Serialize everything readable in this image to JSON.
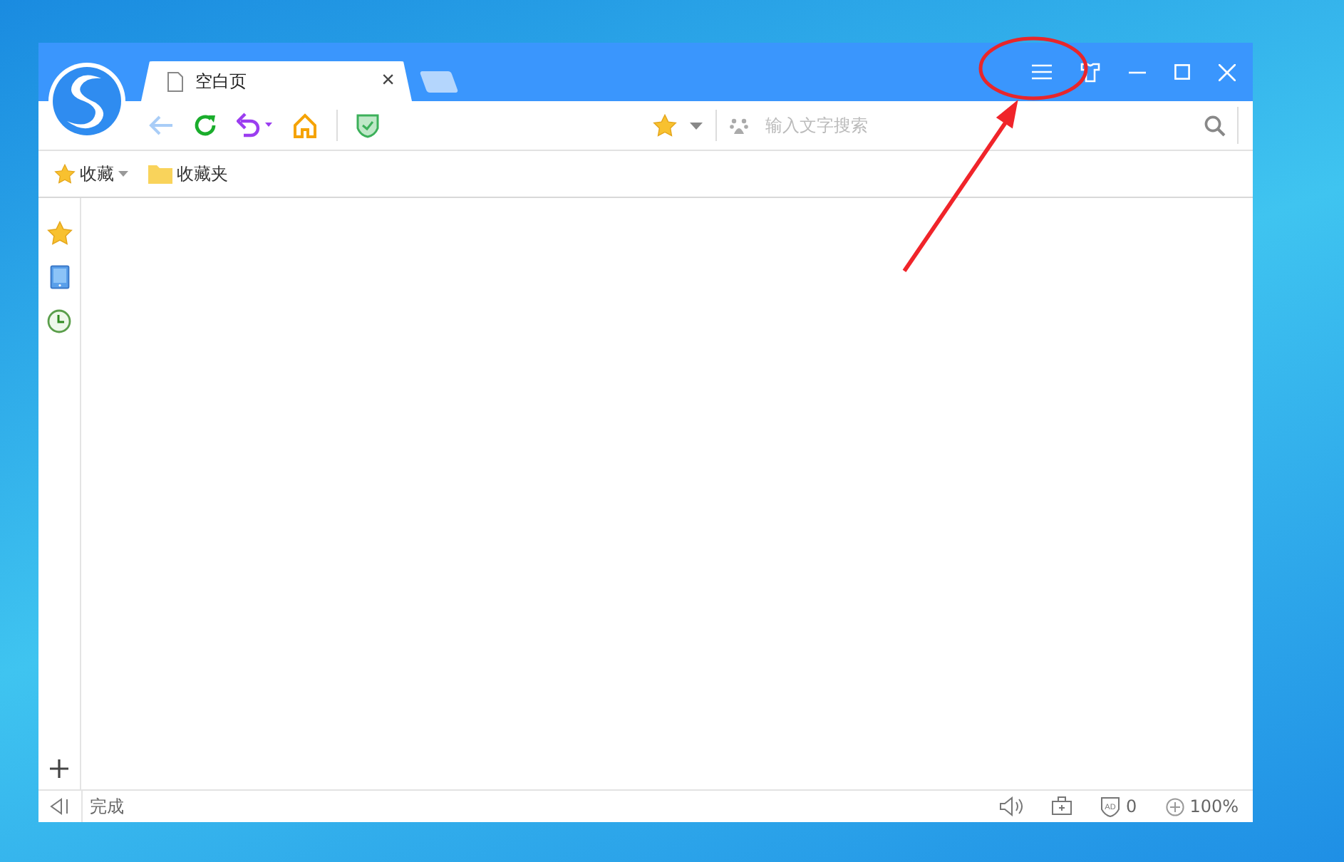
{
  "tabs": [
    {
      "title": "空白页",
      "selected": true,
      "close": "×"
    }
  ],
  "search": {
    "placeholder": "输入文字搜索"
  },
  "bookmarks_bar": [
    {
      "kind": "menu",
      "label": "收藏"
    },
    {
      "kind": "folder",
      "label": "收藏夹"
    }
  ],
  "status_bar": {
    "status": "完成",
    "ad_count": "0",
    "zoom": "100%",
    "ad_label": "AD"
  }
}
